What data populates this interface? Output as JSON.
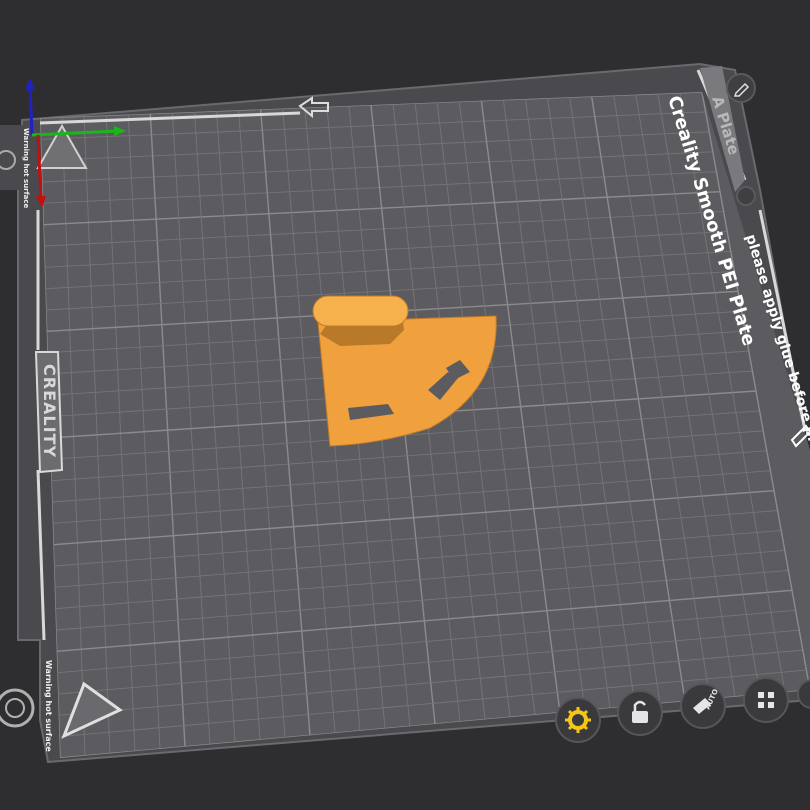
{
  "app": {
    "view": "3D print bed preparation view"
  },
  "plate": {
    "name": "A Plate",
    "sheet_title": "Creality Smooth PEI Plate",
    "glue_note": "please apply glue before print",
    "brand": "CREALITY",
    "warning_top_left": "Warning hot surface",
    "warning_bottom_left": "Warning hot surface",
    "colors": {
      "bed": "#5a5a5e",
      "grid": "#7a7a80",
      "frame": "#4a4a4e",
      "model": "#f0a03c"
    }
  },
  "axes": {
    "x_color": "#18b818",
    "y_color": "#c01010",
    "z_color": "#2020c8"
  },
  "toolbar": {
    "settings_icon": "gear-icon",
    "lock_icon": "lock-icon",
    "auto_orient_icon": "auto-orient-icon",
    "auto_label": "AUTO",
    "arrange_icon": "arrange-grid-icon",
    "accent": "#f5c518"
  }
}
